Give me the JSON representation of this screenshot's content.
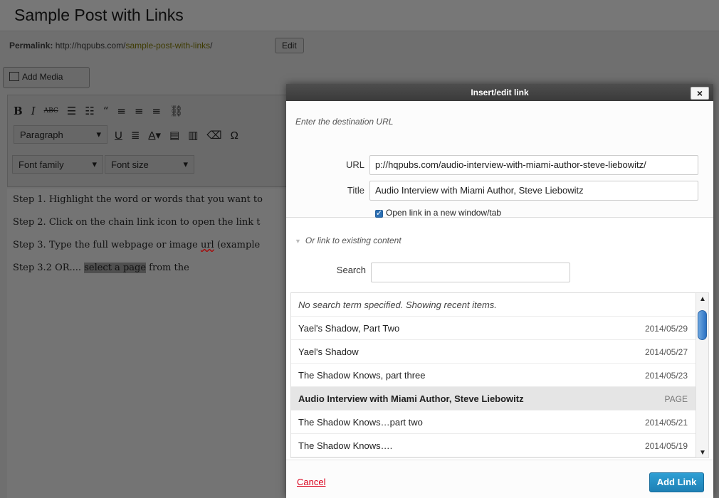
{
  "editor": {
    "post_title": "Sample Post with Links",
    "permalink_label": "Permalink:",
    "permalink_base": "http://hqpubs.com/",
    "permalink_slug": "sample-post-with-links",
    "permalink_end": "/",
    "edit_label": "Edit",
    "add_media_label": "Add Media",
    "format_select": "Paragraph",
    "font_family_select": "Font family",
    "font_size_select": "Font size",
    "toolbar_icons_row1": [
      "bold-icon",
      "italic-icon",
      "strikethrough-icon",
      "bullet-list-icon",
      "numbered-list-icon",
      "blockquote-icon",
      "align-left-icon",
      "align-center-icon",
      "align-right-icon",
      "link-icon"
    ],
    "toolbar_icons_row2": [
      "underline-icon",
      "justify-icon",
      "text-color-icon",
      "paste-text-icon",
      "paste-word-icon",
      "clear-formatting-icon",
      "special-char-icon"
    ],
    "content": {
      "step1": "Step 1. Highlight the word or words that you want to",
      "step2": "Step 2. Click on the chain link icon to open the link t",
      "step3_pre": "Step 3. Type the  full webpage or image ",
      "step3_url": "url",
      "step3_post": " (example",
      "step32_pre": "Step 3.2  OR.... ",
      "step32_hl": "select a page",
      "step32_post": " from the"
    }
  },
  "modal": {
    "title": "Insert/edit link",
    "close_label": "×",
    "url_hint": "Enter the destination URL",
    "url_label": "URL",
    "url_value": "p://hqpubs.com/audio-interview-with-miami-author-steve-liebowitz/",
    "title_label": "Title",
    "title_value": "Audio Interview with Miami Author, Steve Liebowitz",
    "new_tab_label": "Open link in a new window/tab",
    "new_tab_checked": true,
    "existing_toggle": "Or link to existing content",
    "search_label": "Search",
    "search_value": "",
    "results_notice": "No search term specified. Showing recent items.",
    "results": [
      {
        "title": "Yael's Shadow, Part Two",
        "info": "2014/05/29"
      },
      {
        "title": "Yael's Shadow",
        "info": "2014/05/27"
      },
      {
        "title": "The Shadow Knows, part three",
        "info": "2014/05/23"
      },
      {
        "title": "Audio Interview with Miami Author, Steve Liebowitz",
        "info": "PAGE",
        "selected": true
      },
      {
        "title": "The Shadow Knows…part two",
        "info": "2014/05/21"
      },
      {
        "title": "The Shadow Knows….",
        "info": "2014/05/19"
      }
    ],
    "cancel_label": "Cancel",
    "add_link_label": "Add Link"
  },
  "colors": {
    "primary_button": "#1e80b5",
    "cancel_link": "#d9001b",
    "scroll_thumb": "#2a71c2"
  }
}
